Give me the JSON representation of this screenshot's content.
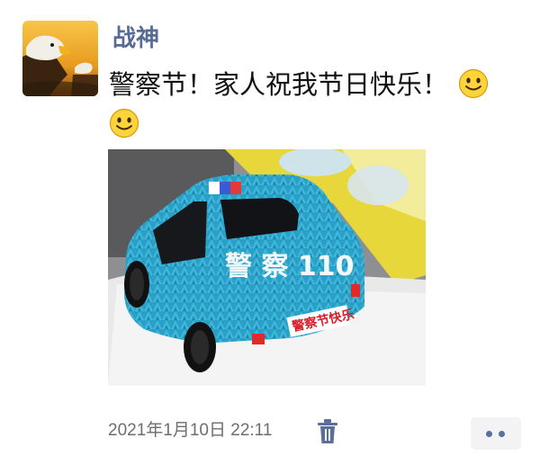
{
  "post": {
    "author": "战神",
    "text": "警察节！家人祝我节日快乐！",
    "emoji": [
      "smile-emoji",
      "smile-emoji"
    ],
    "timestamp": "2021年1月10日 22:11"
  },
  "photo": {
    "cake_text_plate": "警察节快乐",
    "cake_text_side": "警 察 110"
  },
  "colors": {
    "author_name": "#576b95",
    "body_text": "#111111",
    "timestamp": "#6e6e6e",
    "more_dots": "#5a6f99",
    "cake_blue": "#2fa3c8"
  },
  "icons": {
    "delete": "trash-icon",
    "more": "more-dots-icon"
  }
}
